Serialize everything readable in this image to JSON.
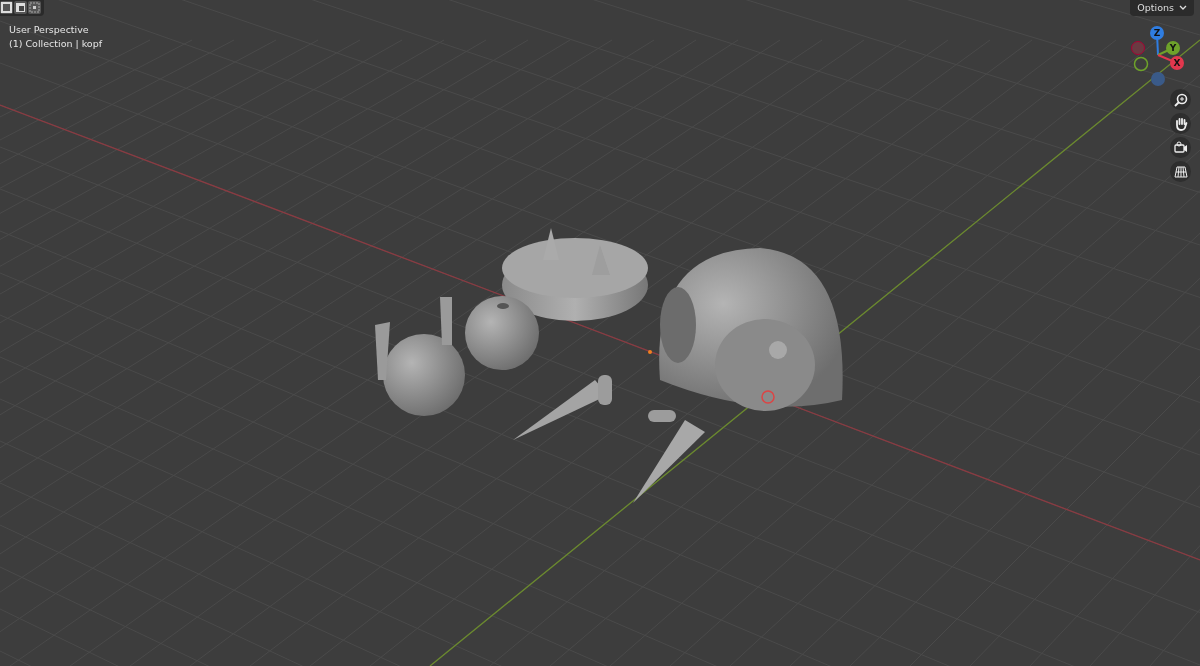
{
  "viewport": {
    "view_name": "User Perspective",
    "collection_info": "(1) Collection | kopf"
  },
  "header_buttons": [
    {
      "kind": "select-box"
    },
    {
      "kind": "select-extend"
    },
    {
      "kind": "select-subtract"
    }
  ],
  "options_button": {
    "label": "Options"
  },
  "gizmo_axes": [
    {
      "label": "Z",
      "color": "#2f7de1"
    },
    {
      "label": "Y",
      "color": "#6ea22a"
    },
    {
      "label": "X",
      "color": "#e2374d"
    }
  ],
  "nav_buttons": [
    {
      "kind": "zoom"
    },
    {
      "kind": "pan"
    },
    {
      "kind": "camera"
    },
    {
      "kind": "grid"
    }
  ]
}
